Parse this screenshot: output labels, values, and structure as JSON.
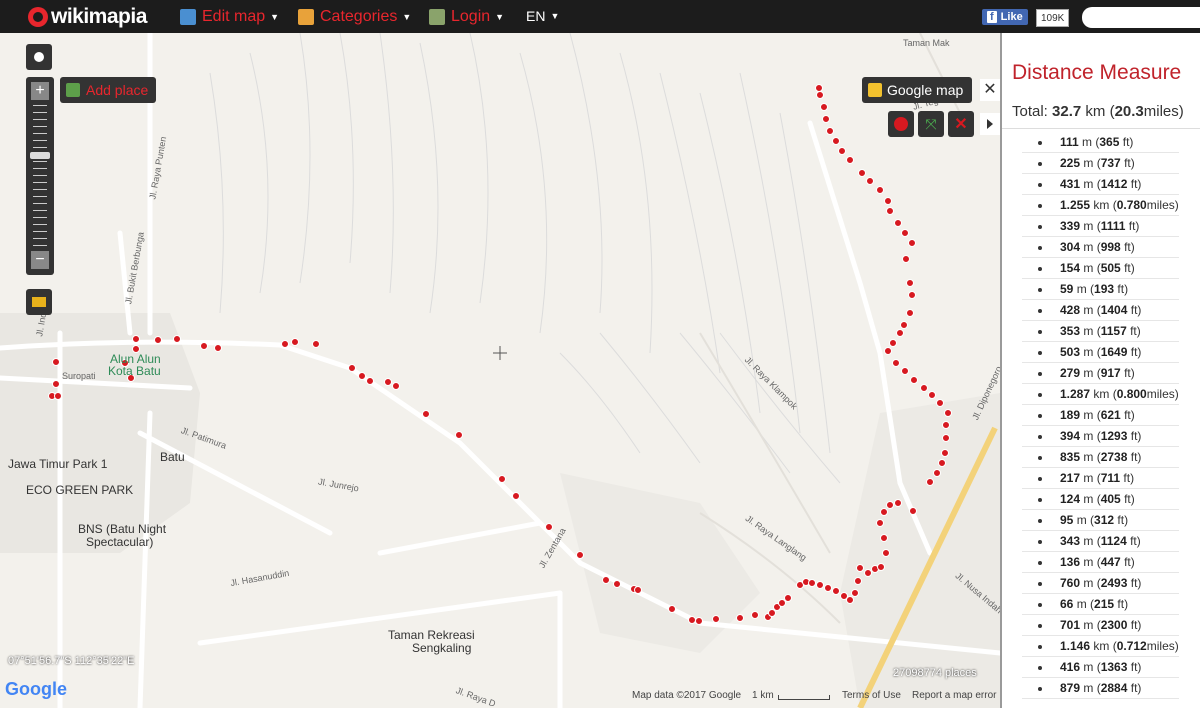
{
  "header": {
    "logo": "wikimapia",
    "menu": [
      {
        "label": "Edit map",
        "icon": "edit-map-icon"
      },
      {
        "label": "Categories",
        "icon": "categories-icon"
      },
      {
        "label": "Login",
        "icon": "login-icon"
      },
      {
        "label": "EN",
        "icon": ""
      }
    ],
    "fb_like": "Like",
    "fb_count": "109K",
    "search_placeholder": ""
  },
  "map": {
    "add_place": "Add place",
    "google_map": "Google map",
    "coords": "07°51'56.7\"S 112°35'22\"E",
    "places_count": "27098774 places",
    "map_data": "Map data ©2017 Google",
    "scale": "1 km",
    "terms": "Terms of Use",
    "report": "Report a map error",
    "google_logo": "Google",
    "labels": {
      "alun_alun": "Alun Alun",
      "kota_batu": "Kota Batu",
      "suropati": "Suropati",
      "batu": "Batu",
      "jawa_timur": "Jawa Timur Park 1",
      "eco_green": "ECO GREEN PARK",
      "bns_1": "BNS (Batu Night",
      "bns_2": "Spectacular)",
      "taman_1": "Taman Rekreasi",
      "taman_2": "Sengkaling",
      "taman_mak": "Taman Mak",
      "jl_patimura": "Jl. Patimura",
      "jl_junrejo": "Jl. Junrejo",
      "jl_hasanuddin": "Jl. Hasanuddin",
      "jl_raya_klampok": "Jl. Raya Klampok",
      "jl_raya_langlang": "Jl. Raya Langlang",
      "jl_zentana": "Jl. Zentana",
      "jl_tegal_rejo": "Jl. Tegal Rejo",
      "jl_diponegoro": "Jl. Diponegoro",
      "jl_nusa_indah": "Jl. Nusa Indah",
      "jl_bukit_berbunga": "Jl. Bukit Berbunga",
      "jl_raya_punten": "Jl. Raya Punten",
      "jl_indr": "Jl. Indr",
      "jl_raya_d": "Jl. Raya D"
    }
  },
  "panel": {
    "title": "Distance Measure",
    "total_prefix": "Total: ",
    "total_km": "32.7",
    "total_unit": " km (",
    "total_miles": "20.3",
    "total_suffix": "miles)",
    "segments": [
      {
        "v": "111",
        "u": " m (",
        "c": "365",
        "cu": " ft)"
      },
      {
        "v": "225",
        "u": " m (",
        "c": "737",
        "cu": " ft)"
      },
      {
        "v": "431",
        "u": " m (",
        "c": "1412",
        "cu": " ft)"
      },
      {
        "v": "1.255",
        "u": " km (",
        "c": "0.780",
        "cu": "miles)"
      },
      {
        "v": "339",
        "u": " m (",
        "c": "1111",
        "cu": " ft)"
      },
      {
        "v": "304",
        "u": " m (",
        "c": "998",
        "cu": " ft)"
      },
      {
        "v": "154",
        "u": " m (",
        "c": "505",
        "cu": " ft)"
      },
      {
        "v": "59",
        "u": " m (",
        "c": "193",
        "cu": " ft)"
      },
      {
        "v": "428",
        "u": " m (",
        "c": "1404",
        "cu": " ft)"
      },
      {
        "v": "353",
        "u": " m (",
        "c": "1157",
        "cu": " ft)"
      },
      {
        "v": "503",
        "u": " m (",
        "c": "1649",
        "cu": " ft)"
      },
      {
        "v": "279",
        "u": " m (",
        "c": "917",
        "cu": " ft)"
      },
      {
        "v": "1.287",
        "u": " km (",
        "c": "0.800",
        "cu": "miles)"
      },
      {
        "v": "189",
        "u": " m (",
        "c": "621",
        "cu": " ft)"
      },
      {
        "v": "394",
        "u": " m (",
        "c": "1293",
        "cu": " ft)"
      },
      {
        "v": "835",
        "u": " m (",
        "c": "2738",
        "cu": " ft)"
      },
      {
        "v": "217",
        "u": " m (",
        "c": "711",
        "cu": " ft)"
      },
      {
        "v": "124",
        "u": " m (",
        "c": "405",
        "cu": " ft)"
      },
      {
        "v": "95",
        "u": " m (",
        "c": "312",
        "cu": " ft)"
      },
      {
        "v": "343",
        "u": " m (",
        "c": "1124",
        "cu": " ft)"
      },
      {
        "v": "136",
        "u": " m (",
        "c": "447",
        "cu": " ft)"
      },
      {
        "v": "760",
        "u": " m (",
        "c": "2493",
        "cu": " ft)"
      },
      {
        "v": "66",
        "u": " m (",
        "c": "215",
        "cu": " ft)"
      },
      {
        "v": "701",
        "u": " m (",
        "c": "2300",
        "cu": " ft)"
      },
      {
        "v": "1.146",
        "u": " km (",
        "c": "0.712",
        "cu": "miles)"
      },
      {
        "v": "416",
        "u": " m (",
        "c": "1363",
        "cu": " ft)"
      },
      {
        "v": "879",
        "u": " m (",
        "c": "2884",
        "cu": " ft)"
      }
    ]
  },
  "colors": {
    "accent": "#e8262d",
    "panel_title": "#c0232b",
    "marker": "#d71920",
    "topbar": "#1c1c1c"
  }
}
